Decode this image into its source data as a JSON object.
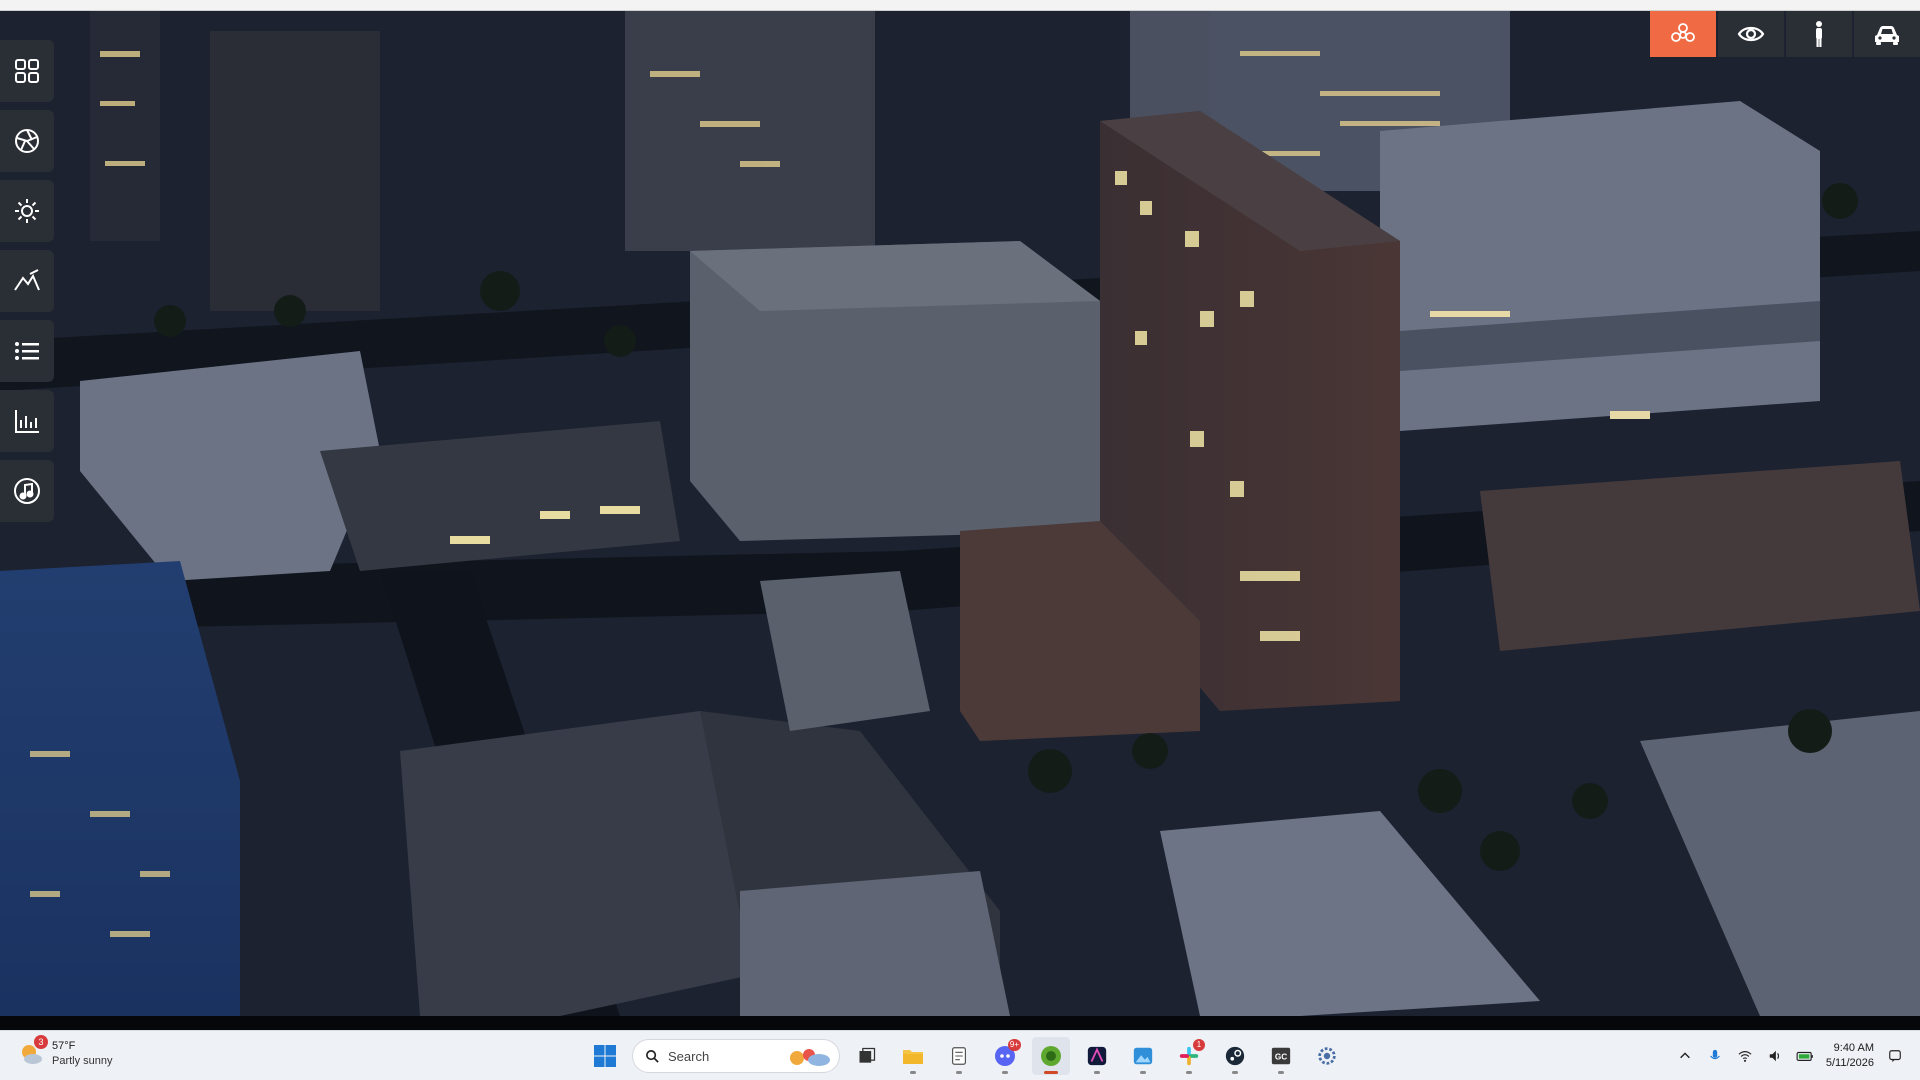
{
  "taskbar": {
    "weather": {
      "temperature": "57°F",
      "condition": "Partly sunny",
      "badge": "3"
    },
    "search_label": "Search",
    "apps": [
      {
        "name": "task-view",
        "badge": ""
      },
      {
        "name": "file-explorer",
        "badge": ""
      },
      {
        "name": "notepad",
        "badge": ""
      },
      {
        "name": "discord",
        "badge": "9+"
      },
      {
        "name": "city-builder",
        "badge": ""
      },
      {
        "name": "affinity",
        "badge": ""
      },
      {
        "name": "photos",
        "badge": ""
      },
      {
        "name": "slack",
        "badge": "1"
      },
      {
        "name": "steam",
        "badge": ""
      },
      {
        "name": "gc-app",
        "badge": ""
      },
      {
        "name": "settings",
        "badge": ""
      }
    ],
    "time": "9:40 AM",
    "date": "5/11/2026"
  },
  "colors": {
    "accent": "#f06a43",
    "rail_bg": "#2a2e35",
    "taskbar_bg": "#eef1f6"
  },
  "rail_icons": [
    "grid-icon",
    "aperture-icon",
    "sun-icon",
    "terrain-icon",
    "list-icon",
    "chart-icon",
    "music-icon"
  ],
  "mode_icons": [
    "network-icon",
    "eye-icon",
    "person-icon",
    "car-icon"
  ]
}
